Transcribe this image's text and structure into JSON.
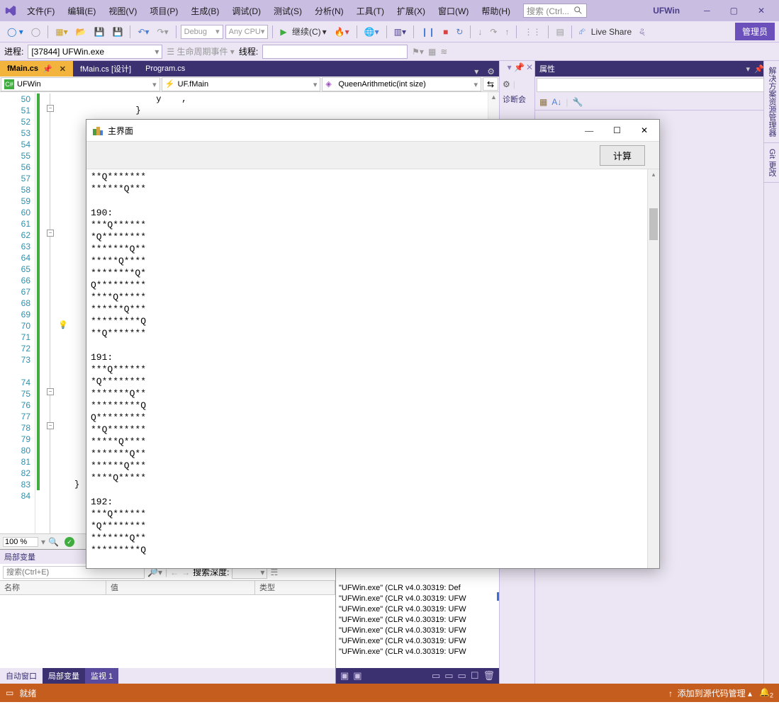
{
  "title": {
    "app": "UFWin"
  },
  "menu": {
    "file": "文件(F)",
    "edit": "编辑(E)",
    "view": "视图(V)",
    "project": "项目(P)",
    "build": "生成(B)",
    "debug": "调试(D)",
    "test": "测试(S)",
    "analyze": "分析(N)",
    "tools": "工具(T)",
    "ext": "扩展(X)",
    "window": "窗口(W)",
    "help": "帮助(H)"
  },
  "search": {
    "ph": "搜索 (Ctrl..."
  },
  "toolbar": {
    "cfg": "Debug",
    "plat": "Any CPU",
    "cont": "继续(C)",
    "live": "Live Share",
    "admin": "管理员"
  },
  "toolbar2": {
    "proc": "进程:",
    "procval": "[37844] UFWin.exe",
    "life": "生命周期事件",
    "thread": "线程:"
  },
  "tabs": {
    "t1": "fMain.cs",
    "t2": "fMain.cs [设计]",
    "t3": "Program.cs"
  },
  "nav": {
    "a": "UFWin",
    "b": "UF.fMain",
    "c": "QueenArithmetic(int size)"
  },
  "gutter": [
    "50",
    "51",
    "52",
    "53",
    "54",
    "55",
    "56",
    "57",
    "58",
    "59",
    "60",
    "61",
    "62",
    "63",
    "64",
    "65",
    "66",
    "67",
    "68",
    "69",
    "70",
    "71",
    "72",
    "73",
    "",
    "74",
    "75",
    "76",
    "77",
    "78",
    "79",
    "80",
    "81",
    "82",
    "83",
    "84"
  ],
  "code": "                y    ,\n            }\n\n\n\n\n\n\n\n\n\n\n\n\n\n\n\n\n\n\n\n\n\n\n\n\n\n\n\n\n\n\n\n    }\n}\n",
  "zoom": "100 %",
  "locals": {
    "title": "局部变量",
    "search": "搜索(Ctrl+E)",
    "depth": "搜索深度:",
    "c1": "名称",
    "c2": "值",
    "c3": "类型"
  },
  "btabs": {
    "a": "自动窗口",
    "b": "局部变量",
    "c": "监视 1"
  },
  "mid": {
    "lbl": "诊断会"
  },
  "props": {
    "title": "属性"
  },
  "sidetabs": {
    "a": "解决方案资源管理器",
    "b": "Git 更改"
  },
  "output": [
    "\"UFWin.exe\" (CLR v4.0.30319: Def",
    "\"UFWin.exe\" (CLR v4.0.30319: UFW",
    "\"UFWin.exe\" (CLR v4.0.30319: UFW",
    "\"UFWin.exe\" (CLR v4.0.30319: UFW",
    "\"UFWin.exe\" (CLR v4.0.30319: UFW",
    "\"UFWin.exe\" (CLR v4.0.30319: UFW",
    "\"UFWin.exe\" (CLR v4.0.30319: UFW"
  ],
  "status": {
    "ready": "就绪",
    "add": "添加到源代码管理",
    "bell": "2"
  },
  "dialog": {
    "title": "主界面",
    "calc": "计算",
    "text": "**Q*******\n******Q***\n\n190:\n***Q******\n*Q********\n*******Q**\n*****Q****\n********Q*\nQ*********\n****Q*****\n******Q***\n*********Q\n**Q*******\n\n191:\n***Q******\n*Q********\n*******Q**\n*********Q\nQ*********\n**Q*******\n*****Q****\n*******Q**\n******Q***\n****Q*****\n\n192:\n***Q******\n*Q********\n*******Q**\n*********Q"
  }
}
